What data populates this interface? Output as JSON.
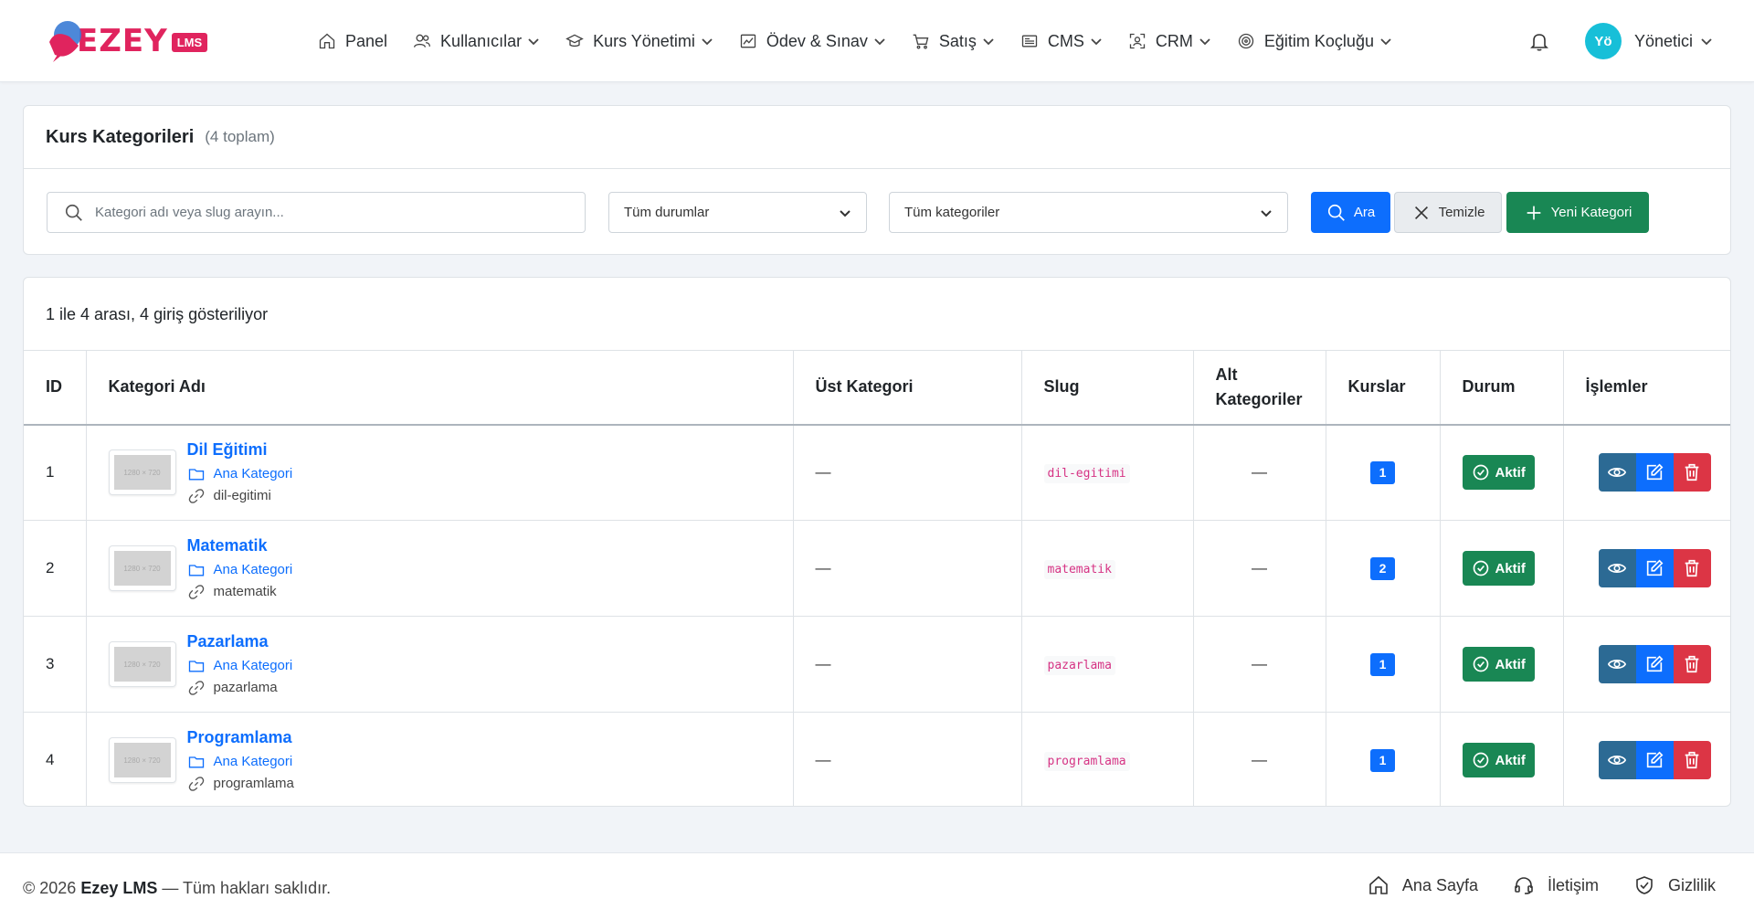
{
  "brand": {
    "name": "EZEY",
    "badge": "LMS",
    "colors": {
      "primary": "#e0245e",
      "accent": "#0d6efd",
      "success": "#198754",
      "danger": "#dc3545"
    }
  },
  "nav": [
    {
      "label": "Panel",
      "icon": "home-icon",
      "dropdown": false
    },
    {
      "label": "Kullanıcılar",
      "icon": "users-icon",
      "dropdown": true
    },
    {
      "label": "Kurs Yönetimi",
      "icon": "graduation-cap-icon",
      "dropdown": true
    },
    {
      "label": "Ödev & Sınav",
      "icon": "chart-icon",
      "dropdown": true
    },
    {
      "label": "Satış",
      "icon": "cart-icon",
      "dropdown": true
    },
    {
      "label": "CMS",
      "icon": "newspaper-icon",
      "dropdown": true
    },
    {
      "label": "CRM",
      "icon": "person-scan-icon",
      "dropdown": true
    },
    {
      "label": "Eğitim Koçluğu",
      "icon": "target-icon",
      "dropdown": true
    }
  ],
  "user": {
    "initials": "Yö",
    "name": "Yönetici"
  },
  "header": {
    "title": "Kurs Kategorileri",
    "count": "(4 toplam)"
  },
  "filters": {
    "search_placeholder": "Kategori adı veya slug arayın...",
    "status_select": "Tüm durumlar",
    "category_select": "Tüm kategoriler",
    "search_button": "Ara",
    "clear_button": "Temizle",
    "new_button": "Yeni Kategori"
  },
  "table": {
    "showing": "1 ile 4 arası, 4 giriş gösteriliyor",
    "columns": [
      "ID",
      "Kategori Adı",
      "Üst Kategori",
      "Slug",
      "Alt Kategoriler",
      "Kurslar",
      "Durum",
      "İşlemler"
    ],
    "thumb_text": "1280 × 720",
    "rows": [
      {
        "id": "1",
        "name": "Dil Eğitimi",
        "parent_label": "Ana Kategori",
        "slug_text": "dil-egitimi",
        "parent": "—",
        "slug": "dil-egitimi",
        "subcategories": "—",
        "courses": "1",
        "status": "Aktif"
      },
      {
        "id": "2",
        "name": "Matematik",
        "parent_label": "Ana Kategori",
        "slug_text": "matematik",
        "parent": "—",
        "slug": "matematik",
        "subcategories": "—",
        "courses": "2",
        "status": "Aktif"
      },
      {
        "id": "3",
        "name": "Pazarlama",
        "parent_label": "Ana Kategori",
        "slug_text": "pazarlama",
        "parent": "—",
        "slug": "pazarlama",
        "subcategories": "—",
        "courses": "1",
        "status": "Aktif"
      },
      {
        "id": "4",
        "name": "Programlama",
        "parent_label": "Ana Kategori",
        "slug_text": "programlama",
        "parent": "—",
        "slug": "programlama",
        "subcategories": "—",
        "courses": "1",
        "status": "Aktif"
      }
    ]
  },
  "footer": {
    "year": "© 2026",
    "brand": "Ezey LMS",
    "rights": "— Tüm hakları saklıdır.",
    "links": [
      {
        "label": "Ana Sayfa",
        "icon": "home-icon"
      },
      {
        "label": "İletişim",
        "icon": "headset-icon"
      },
      {
        "label": "Gizlilik",
        "icon": "shield-icon"
      }
    ]
  }
}
